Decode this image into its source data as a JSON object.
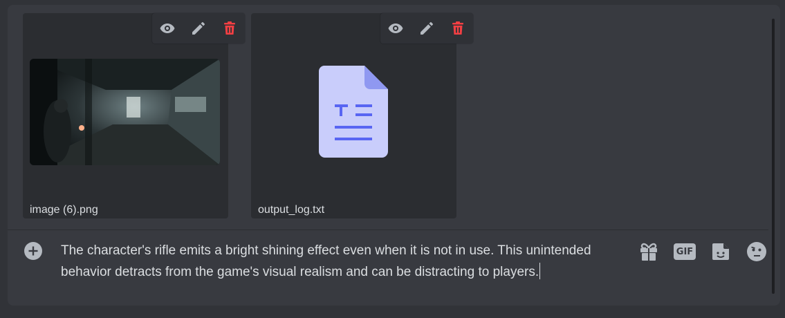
{
  "attachments": [
    {
      "filename": "image (6).png",
      "type": "image",
      "thumbnail_icon": "game-screenshot-thumbnail"
    },
    {
      "filename": "output_log.txt",
      "type": "text",
      "file_icon": "text-file-icon"
    }
  ],
  "attachment_actions": [
    "eye-icon",
    "pencil-icon",
    "trash-icon"
  ],
  "message": {
    "text": "The character's rifle emits a bright shining effect even when it is not in use. This unintended behavior detracts from the game's visual realism and can be distracting to players."
  },
  "toolbar": {
    "gif_label": "GIF",
    "icons": [
      "gift-icon",
      "gif-icon",
      "sticker-icon",
      "emoji-icon"
    ]
  },
  "colors": {
    "background": "#313338",
    "composer": "#383a40",
    "card": "#2b2d31",
    "delete_red": "#f23f43",
    "icon_grey": "#b5bac1",
    "file_icon": "#c9cdfb",
    "file_accent": "#5865f2"
  }
}
